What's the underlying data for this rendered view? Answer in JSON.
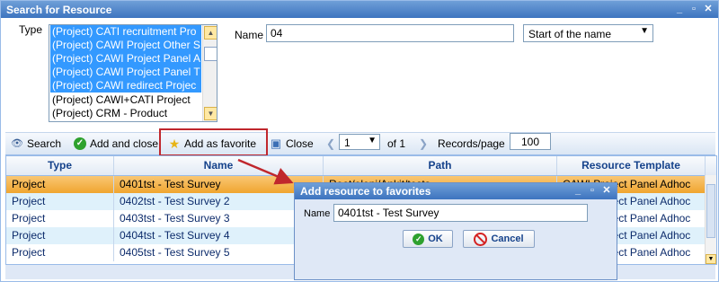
{
  "window": {
    "title": "Search for Resource"
  },
  "filters": {
    "type_label": "Type",
    "type_options": [
      {
        "label": "(Project) CATI recruitment Pro",
        "selected": true
      },
      {
        "label": "(Project) CAWI Project Other S",
        "selected": true
      },
      {
        "label": "(Project) CAWI Project Panel A",
        "selected": true
      },
      {
        "label": "(Project) CAWI Project Panel T",
        "selected": true
      },
      {
        "label": "(Project) CAWI redirect Projec",
        "selected": true
      },
      {
        "label": "(Project) CAWI+CATI Project",
        "selected": false
      },
      {
        "label": "(Project) CRM - Product",
        "selected": false
      }
    ],
    "name_label": "Name",
    "name_value": "04",
    "match_value": "Start of the name"
  },
  "toolbar": {
    "search": "Search",
    "add_close": "Add and close",
    "add_favorite": "Add as favorite",
    "close": "Close",
    "page_value": "1",
    "of_pages": "of 1",
    "records_label": "Records/page",
    "records_value": "100"
  },
  "grid": {
    "columns": [
      "Type",
      "Name",
      "Path",
      "Resource Template"
    ],
    "rows": [
      {
        "type": "Project",
        "name": "0401tst - Test Survey",
        "path": "Root/eleni/Ankit/tests",
        "template": "CAWI Project Panel Adhoc",
        "selected": true
      },
      {
        "type": "Project",
        "name": "0402tst - Test Survey 2",
        "path": "",
        "template": "CAWI Project Panel Adhoc",
        "selected": false
      },
      {
        "type": "Project",
        "name": "0403tst - Test Survey 3",
        "path": "",
        "template": "CAWI Project Panel Adhoc",
        "selected": false
      },
      {
        "type": "Project",
        "name": "0404tst - Test Survey 4",
        "path": "",
        "template": "CAWI Project Panel Adhoc",
        "selected": false
      },
      {
        "type": "Project",
        "name": "0405tst - Test Survey 5",
        "path": "",
        "template": "CAWI Project Panel Adhoc",
        "selected": false
      }
    ]
  },
  "dialog": {
    "title": "Add resource to favorites",
    "name_label": "Name",
    "name_value": "0401tst - Test Survey",
    "ok": "OK",
    "cancel": "Cancel"
  },
  "colors": {
    "title_bar": "#3d74bf",
    "selected_row": "#f0a52f",
    "highlight": "#c0272d"
  }
}
